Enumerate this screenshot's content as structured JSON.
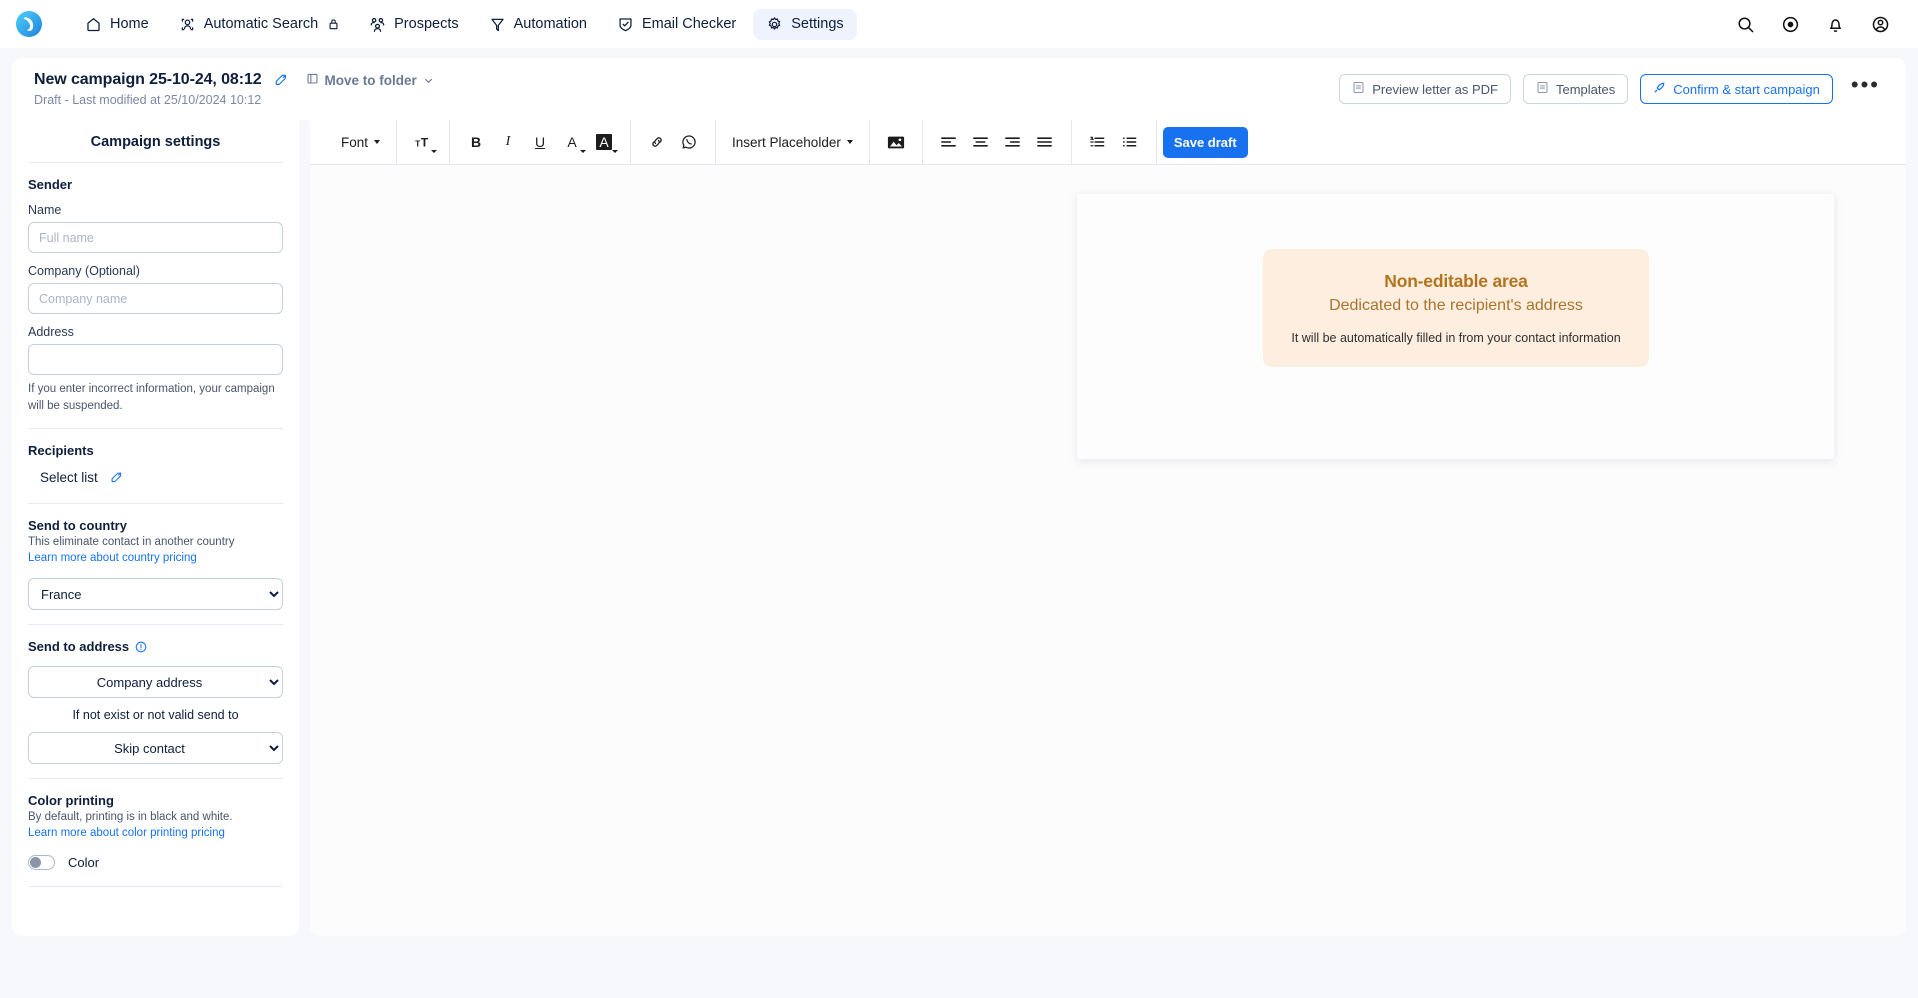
{
  "nav": {
    "logo_icon": "brand-logo-icon",
    "items": [
      {
        "label": "Home",
        "icon": "home-icon",
        "active": false,
        "locked": false
      },
      {
        "label": "Automatic Search",
        "icon": "person-search-icon",
        "active": false,
        "locked": true
      },
      {
        "label": "Prospects",
        "icon": "people-icon",
        "active": false,
        "locked": false
      },
      {
        "label": "Automation",
        "icon": "funnel-icon",
        "active": false,
        "locked": false
      },
      {
        "label": "Email Checker",
        "icon": "shield-check-icon",
        "active": false,
        "locked": false
      },
      {
        "label": "Settings",
        "icon": "gear-icon",
        "active": true,
        "locked": false
      }
    ],
    "right_icons": [
      {
        "name": "search-icon"
      },
      {
        "name": "support-icon"
      },
      {
        "name": "bell-icon"
      },
      {
        "name": "account-icon"
      }
    ],
    "active_bg": "#eef3fd"
  },
  "header": {
    "campaign_title": "New campaign 25-10-24, 08:12",
    "edit_icon": "edit-pencil-icon",
    "move_to_folder": "Move to folder",
    "move_to_folder_icon": "folder-icon",
    "subtitle": "Draft - Last modified at 25/10/2024 10:12",
    "preview_pdf": "Preview letter as PDF",
    "preview_pdf_icon": "pdf-file-icon",
    "templates": "Templates",
    "templates_icon": "template-file-icon",
    "confirm_start": "Confirm & start campaign",
    "confirm_start_icon": "rocket-icon",
    "more_icon": "more-horizontal-icon",
    "accent": "#1872f0"
  },
  "sidebar": {
    "title": "Campaign settings",
    "sender": {
      "heading": "Sender",
      "name_label": "Name",
      "name_value": "",
      "name_placeholder": "Full name",
      "company_label": "Company (Optional)",
      "company_value": "",
      "company_placeholder": "Company name",
      "address_label": "Address",
      "address_value": "",
      "address_placeholder": "",
      "warning": "If you enter incorrect information, your campaign will be suspended."
    },
    "recipients": {
      "heading": "Recipients",
      "select_list_label": "Select list",
      "select_list_icon": "edit-pencil-icon"
    },
    "country": {
      "heading": "Send to country",
      "description": "This eliminate contact in another country",
      "link": "Learn more about country pricing",
      "selected": "France",
      "options": [
        "France"
      ]
    },
    "send_to_address": {
      "heading": "Send to address",
      "info_icon": "info-circle-icon",
      "primary_selected": "Company address",
      "primary_options": [
        "Company address"
      ],
      "fallback_note": "If not exist or not valid send to",
      "fallback_selected": "Skip contact",
      "fallback_options": [
        "Skip contact"
      ]
    },
    "color_printing": {
      "heading": "Color printing",
      "description": "By default, printing is in black and white.",
      "link": "Learn more about color printing pricing",
      "toggle_label": "Color",
      "toggle_on": false
    }
  },
  "toolbar": {
    "font_label": "Font",
    "font_size_icon": "text-size-icon",
    "bold_label": "B",
    "italic_label": "I",
    "underline_label": "U",
    "text_color_label": "A",
    "highlight_label": "A",
    "link_icon": "link-icon",
    "whatsapp_icon": "whatsapp-icon",
    "insert_placeholder": "Insert Placeholder",
    "image_icon": "image-icon",
    "align_left_icon": "align-left-icon",
    "align_center_icon": "align-center-icon",
    "align_right_icon": "align-right-icon",
    "align_justify_icon": "align-justify-icon",
    "ordered_list_icon": "ordered-list-icon",
    "bullet_list_icon": "bullet-list-icon",
    "save_draft": "Save draft",
    "save_draft_color": "#1872f0"
  },
  "document": {
    "non_editable_title": "Non-editable area",
    "non_editable_subtitle": "Dedicated to the recipient's address",
    "non_editable_note": "It will be automatically filled in from your contact information",
    "block_bg": "#fdeedf",
    "block_title_color": "#b3741d"
  }
}
